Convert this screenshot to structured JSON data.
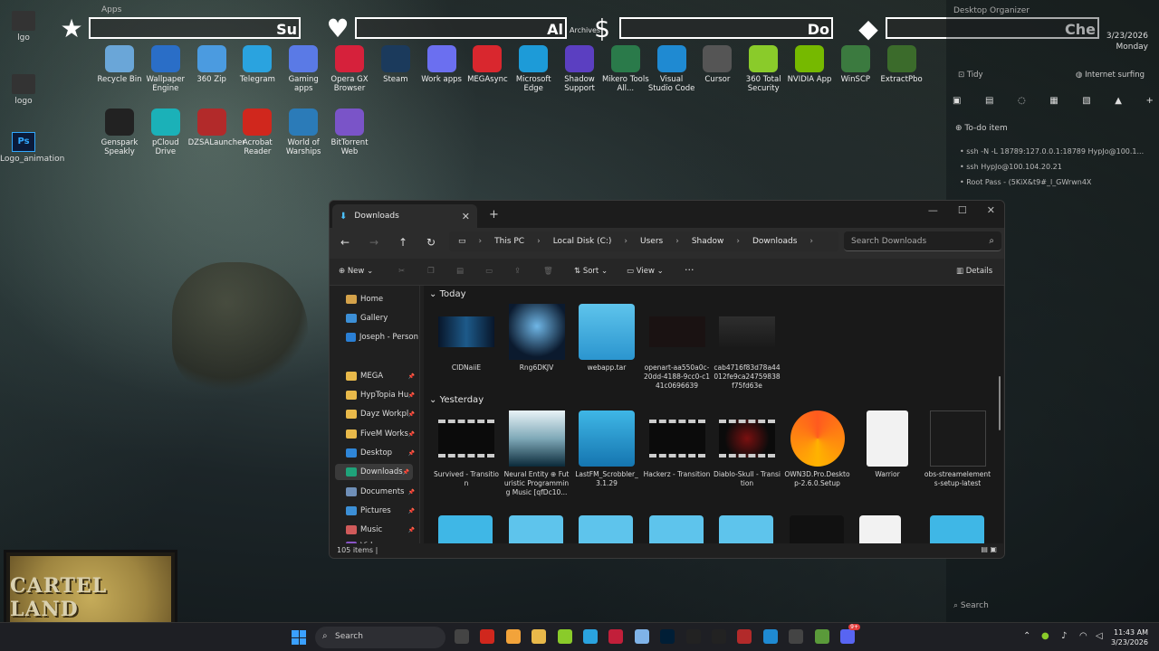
{
  "desktop": {
    "apps_label": "Apps",
    "archives_label": "Archives",
    "left_icons": [
      {
        "label": "lgo"
      },
      {
        "label": "logo"
      },
      {
        "label": "Logo_animation",
        "badge": "PSD"
      }
    ],
    "header_bars": [
      {
        "emblem": "★",
        "label": "Su",
        "icon": "star-icon"
      },
      {
        "emblem": "♥",
        "label": "Al",
        "icon": "heart-icon"
      },
      {
        "emblem": "$",
        "label": "Do",
        "icon": "dollar-icon"
      },
      {
        "emblem": "◆",
        "label": "Che",
        "icon": "diamond-icon"
      }
    ],
    "row1": [
      {
        "label": "Recycle Bin",
        "color": "#6aa6d8"
      },
      {
        "label": "Wallpaper Engine",
        "color": "#2a6ec7"
      },
      {
        "label": "360 Zip",
        "color": "#4b9be0"
      },
      {
        "label": "Telegram",
        "color": "#2aa3df"
      },
      {
        "label": "Gaming apps",
        "color": "#5a7ae6"
      },
      {
        "label": "Opera GX Browser",
        "color": "#d6213b"
      },
      {
        "label": "Steam",
        "color": "#1b3a5c"
      },
      {
        "label": "Work apps",
        "color": "#6b6ff0"
      },
      {
        "label": "MEGAsync",
        "color": "#d9272e"
      },
      {
        "label": "Microsoft Edge",
        "color": "#1d9bd8"
      },
      {
        "label": "Shadow Support",
        "color": "#5b3fc1"
      },
      {
        "label": "Mikero Tools All...",
        "color": "#2a7a4a"
      },
      {
        "label": "Visual Studio Code",
        "color": "#1f8ad2"
      },
      {
        "label": "Cursor",
        "color": "#555555"
      },
      {
        "label": "360 Total Security",
        "color": "#8acb2a"
      },
      {
        "label": "NVIDIA App",
        "color": "#76b900"
      },
      {
        "label": "WinSCP",
        "color": "#3b7a3f"
      },
      {
        "label": "ExtractPbo",
        "color": "#3b6b2b"
      }
    ],
    "row2": [
      {
        "label": "Genspark Speakly",
        "color": "#222222"
      },
      {
        "label": "pCloud Drive",
        "color": "#1bb1b8"
      },
      {
        "label": "DZSALauncher",
        "color": "#b22a2a"
      },
      {
        "label": "Acrobat Reader",
        "color": "#d0271d"
      },
      {
        "label": "World of Warships",
        "color": "#2b7bb8"
      },
      {
        "label": "BitTorrent Web",
        "color": "#7a54c8"
      }
    ]
  },
  "right_panel": {
    "title": "Desktop Organizer",
    "time_partial": "11:43",
    "date": "3/23/2026",
    "day": "Monday",
    "tidy": "Tidy",
    "surf": "Internet surfing",
    "todo_label": "To-do item",
    "todos": [
      "ssh -N -L 18789:127.0.0.1:18789 HypJo@100.1...",
      "ssh HypJo@100.104.20.21",
      "Root Pass - (5KiX&t9#_l_GWrwn4X"
    ],
    "search": "Search"
  },
  "webcam": {
    "logo": "CARTEL LAND"
  },
  "explorer": {
    "tab_title": "Downloads",
    "breadcrumbs": [
      "This PC",
      "Local Disk (C:)",
      "Users",
      "Shadow",
      "Downloads"
    ],
    "search_placeholder": "Search Downloads",
    "commands": {
      "new": "New",
      "sort": "Sort",
      "view": "View",
      "details": "Details"
    },
    "nav": [
      {
        "label": "Home",
        "color": "#d4a24a"
      },
      {
        "label": "Gallery",
        "color": "#3c8fd6"
      },
      {
        "label": "Joseph - Person",
        "color": "#2a7fd4"
      },
      {
        "label": "MEGA",
        "color": "#e8b94a"
      },
      {
        "label": "HypTopia Hu",
        "color": "#e8b94a"
      },
      {
        "label": "Dayz Workpl",
        "color": "#e8b94a"
      },
      {
        "label": "FiveM Works",
        "color": "#e8b94a"
      },
      {
        "label": "Desktop",
        "color": "#2f86d8"
      },
      {
        "label": "Downloads",
        "color": "#1fa37a"
      },
      {
        "label": "Documents",
        "color": "#6f8fb8"
      },
      {
        "label": "Pictures",
        "color": "#3c8fd6"
      },
      {
        "label": "Music",
        "color": "#d05a5a"
      },
      {
        "label": "Videos",
        "color": "#8a55c8"
      }
    ],
    "groups": {
      "today": "Today",
      "yesterday": "Yesterday"
    },
    "today_files": [
      {
        "name": "CIDNaiiE",
        "kind": "image-blue"
      },
      {
        "name": "Rng6DKJV",
        "kind": "image-titan"
      },
      {
        "name": "webapp.tar",
        "kind": "zip"
      },
      {
        "name": "openart-aa550a0c-20dd-4188-9cc0-c141c0696639",
        "kind": "image-dark"
      },
      {
        "name": "cab4716f83d78a44012fe9ca24759838f75fd63e",
        "kind": "image-grey"
      }
    ],
    "yesterday_files": [
      {
        "name": "Survived - Transition",
        "kind": "video"
      },
      {
        "name": "Neural Entity ⊕ Futuristic Programming Music [qfDc10...",
        "kind": "image-sky"
      },
      {
        "name": "LastFM_Scrobbler_3.1.29",
        "kind": "installer"
      },
      {
        "name": "Hackerz - Transition",
        "kind": "video"
      },
      {
        "name": "Diablo-Skull - Transition",
        "kind": "video-red"
      },
      {
        "name": "OWN3D.Pro.Desktop-2.6.0.Setup",
        "kind": "own3d"
      },
      {
        "name": "Warrior",
        "kind": "json"
      },
      {
        "name": "obs-streamelements-setup-latest",
        "kind": "setup"
      }
    ],
    "status": "105 items"
  },
  "taskbar": {
    "search": "Search",
    "time": "11:43 AM",
    "date": "3/23/2026",
    "badge": "9+"
  }
}
